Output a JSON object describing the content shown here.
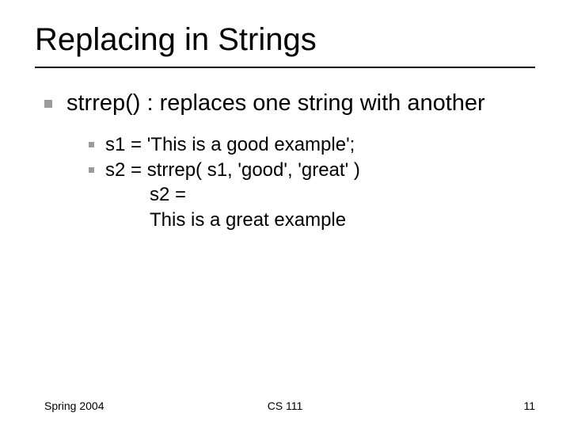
{
  "title": "Replacing in Strings",
  "bullets": {
    "lvl1": "strrep() : replaces one string with another",
    "lvl2a": "s1 = 'This is a good example';",
    "lvl2b": "s2 = strrep( s1, 'good', 'great' )",
    "out1": "s2 =",
    "out2": "This is a great example"
  },
  "footer": {
    "left": "Spring 2004",
    "center": "CS 111",
    "right": "11"
  }
}
